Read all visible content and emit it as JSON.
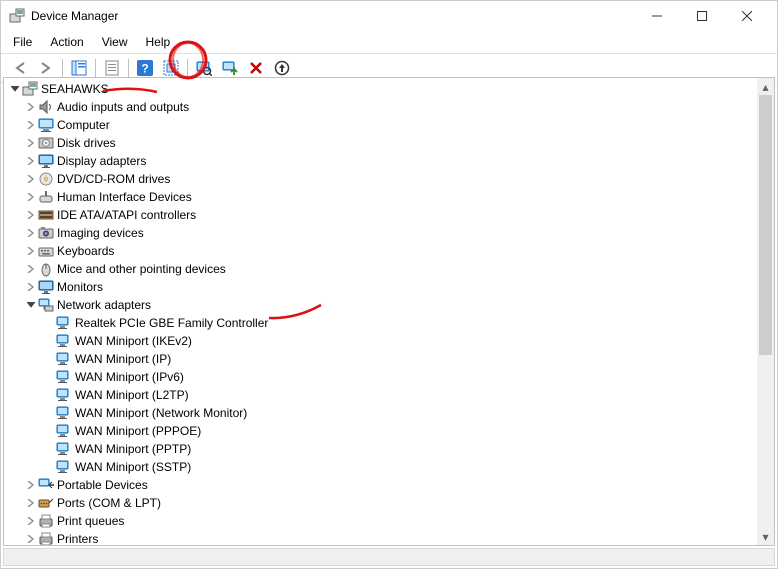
{
  "window": {
    "title": "Device Manager"
  },
  "menu": {
    "file": "File",
    "action": "Action",
    "view": "View",
    "help": "Help"
  },
  "tree": {
    "root": "SEAHAWKS",
    "audio": "Audio inputs and outputs",
    "computer": "Computer",
    "disk": "Disk drives",
    "display": "Display adapters",
    "dvd": "DVD/CD-ROM drives",
    "hid": "Human Interface Devices",
    "ide": "IDE ATA/ATAPI controllers",
    "imaging": "Imaging devices",
    "keyboards": "Keyboards",
    "mice": "Mice and other pointing devices",
    "monitors": "Monitors",
    "network": "Network adapters",
    "net_items": {
      "realtek": "Realtek PCIe GBE Family Controller",
      "ikev2": "WAN Miniport (IKEv2)",
      "ip": "WAN Miniport (IP)",
      "ipv6": "WAN Miniport (IPv6)",
      "l2tp": "WAN Miniport (L2TP)",
      "netmon": "WAN Miniport (Network Monitor)",
      "pppoe": "WAN Miniport (PPPOE)",
      "pptp": "WAN Miniport (PPTP)",
      "sstp": "WAN Miniport (SSTP)"
    },
    "portable": "Portable Devices",
    "ports": "Ports (COM & LPT)",
    "printq": "Print queues",
    "printers": "Printers"
  }
}
